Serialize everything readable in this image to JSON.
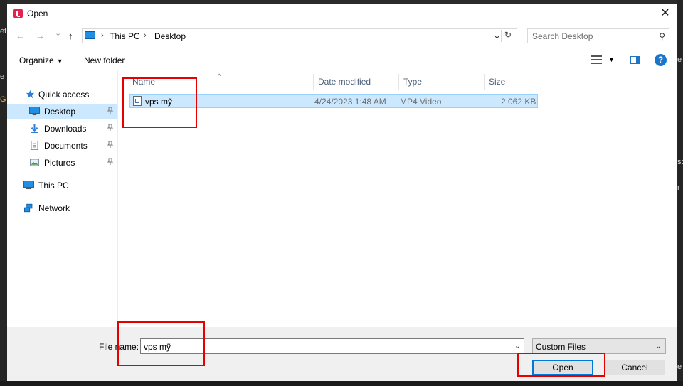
{
  "background": {
    "glyphs": [
      "et",
      "e",
      "G",
      "e",
      "sc",
      "r",
      "e"
    ]
  },
  "dialog": {
    "title": "Open",
    "app_icon": "tiktok-icon",
    "close_glyph": "✕"
  },
  "navigation": {
    "back_glyph": "←",
    "forward_glyph": "→",
    "recent_glyph": "⌄",
    "up_glyph": "↑",
    "breadcrumb": [
      "This PC",
      "Desktop"
    ],
    "breadcrumb_sep": "›",
    "dropdown_glyph": "⌄",
    "refresh_glyph": "↻",
    "search_placeholder": "Search Desktop",
    "search_glyph": "⚲"
  },
  "toolbar": {
    "organize_label": "Organize",
    "dropdown_glyph": "▼",
    "new_folder_label": "New folder",
    "help_glyph": "?"
  },
  "sidebar": {
    "pin_glyph": "📌",
    "items": [
      {
        "label": "Quick access",
        "icon": "star-icon"
      },
      {
        "label": "Desktop",
        "icon": "desktop-icon",
        "selected": true,
        "pinned": true
      },
      {
        "label": "Downloads",
        "icon": "download-icon",
        "pinned": true
      },
      {
        "label": "Documents",
        "icon": "documents-icon",
        "pinned": true
      },
      {
        "label": "Pictures",
        "icon": "pictures-icon",
        "pinned": true
      },
      {
        "label": "This PC",
        "icon": "computer-icon"
      },
      {
        "label": "Network",
        "icon": "network-icon"
      }
    ]
  },
  "file_list": {
    "sort_glyph": "^",
    "columns": [
      "Name",
      "Date modified",
      "Type",
      "Size"
    ],
    "rows": [
      {
        "name": "vps mỹ",
        "date": "4/24/2023 1:48 AM",
        "type": "MP4 Video",
        "size": "2,062 KB",
        "selected": true
      }
    ]
  },
  "footer": {
    "file_name_label": "File name:",
    "file_name_value": "vps mỹ",
    "dropdown_glyph": "⌄",
    "file_type": "Custom Files",
    "open_label": "Open",
    "cancel_label": "Cancel"
  },
  "highlight_color": "#e60000",
  "selection_color": "#cce8ff",
  "accent_color": "#0078d7"
}
